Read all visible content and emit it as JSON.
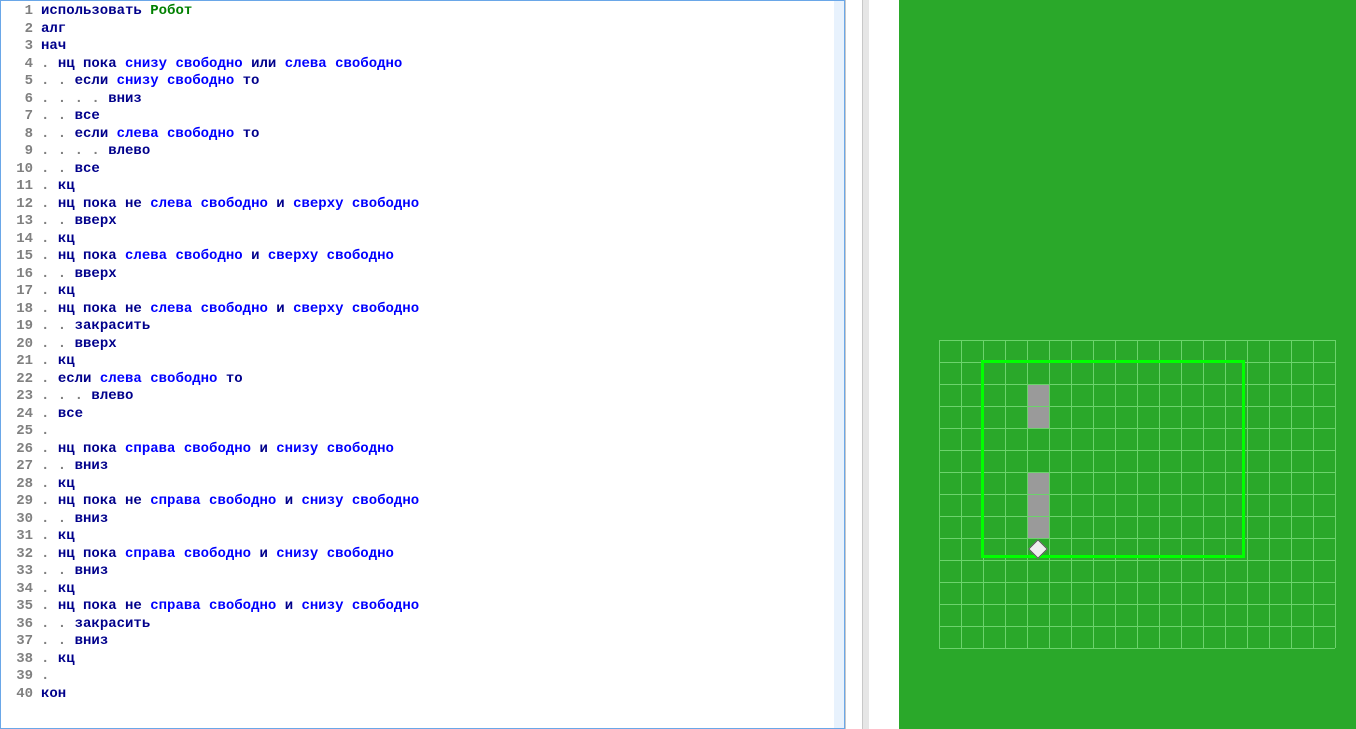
{
  "code": {
    "lines": [
      {
        "n": 1,
        "indent": 0,
        "tokens": [
          [
            "use",
            "использовать"
          ],
          [
            "sp",
            " "
          ],
          [
            "mod",
            "Робот"
          ]
        ]
      },
      {
        "n": 2,
        "indent": 0,
        "tokens": [
          [
            "kw",
            "алг"
          ]
        ]
      },
      {
        "n": 3,
        "indent": 0,
        "tokens": [
          [
            "kw",
            "нач"
          ]
        ]
      },
      {
        "n": 4,
        "indent": 1,
        "tokens": [
          [
            "kw",
            "нц пока"
          ],
          [
            "sp",
            " "
          ],
          [
            "cond",
            "снизу свободно"
          ],
          [
            "sp",
            " "
          ],
          [
            "kw",
            "или"
          ],
          [
            "sp",
            " "
          ],
          [
            "cond",
            "слева свободно"
          ]
        ]
      },
      {
        "n": 5,
        "indent": 2,
        "tokens": [
          [
            "kw",
            "если"
          ],
          [
            "sp",
            " "
          ],
          [
            "cond",
            "снизу свободно"
          ],
          [
            "sp",
            " "
          ],
          [
            "kw",
            "то"
          ]
        ]
      },
      {
        "n": 6,
        "indent": 4,
        "tokens": [
          [
            "cmd",
            "вниз"
          ]
        ]
      },
      {
        "n": 7,
        "indent": 2,
        "tokens": [
          [
            "kw",
            "все"
          ]
        ]
      },
      {
        "n": 8,
        "indent": 2,
        "tokens": [
          [
            "kw",
            "если"
          ],
          [
            "sp",
            " "
          ],
          [
            "cond",
            "слева свободно"
          ],
          [
            "sp",
            " "
          ],
          [
            "kw",
            "то"
          ]
        ]
      },
      {
        "n": 9,
        "indent": 4,
        "tokens": [
          [
            "cmd",
            "влево"
          ]
        ]
      },
      {
        "n": 10,
        "indent": 2,
        "tokens": [
          [
            "kw",
            "все"
          ]
        ]
      },
      {
        "n": 11,
        "indent": 1,
        "tokens": [
          [
            "kw",
            "кц"
          ]
        ]
      },
      {
        "n": 12,
        "indent": 1,
        "tokens": [
          [
            "kw",
            "нц пока"
          ],
          [
            "sp",
            " "
          ],
          [
            "kw",
            "не"
          ],
          [
            "sp",
            " "
          ],
          [
            "cond",
            "слева свободно"
          ],
          [
            "sp",
            " "
          ],
          [
            "kw",
            "и"
          ],
          [
            "sp",
            " "
          ],
          [
            "cond",
            "сверху свободно"
          ]
        ]
      },
      {
        "n": 13,
        "indent": 2,
        "tokens": [
          [
            "cmd",
            "вверх"
          ]
        ]
      },
      {
        "n": 14,
        "indent": 1,
        "tokens": [
          [
            "kw",
            "кц"
          ]
        ]
      },
      {
        "n": 15,
        "indent": 1,
        "tokens": [
          [
            "kw",
            "нц пока"
          ],
          [
            "sp",
            " "
          ],
          [
            "cond",
            "слева свободно"
          ],
          [
            "sp",
            " "
          ],
          [
            "kw",
            "и"
          ],
          [
            "sp",
            " "
          ],
          [
            "cond",
            "сверху свободно"
          ]
        ]
      },
      {
        "n": 16,
        "indent": 2,
        "tokens": [
          [
            "cmd",
            "вверх"
          ]
        ]
      },
      {
        "n": 17,
        "indent": 1,
        "tokens": [
          [
            "kw",
            "кц"
          ]
        ]
      },
      {
        "n": 18,
        "indent": 1,
        "tokens": [
          [
            "kw",
            "нц пока"
          ],
          [
            "sp",
            " "
          ],
          [
            "kw",
            "не"
          ],
          [
            "sp",
            " "
          ],
          [
            "cond",
            "слева свободно"
          ],
          [
            "sp",
            " "
          ],
          [
            "kw",
            "и"
          ],
          [
            "sp",
            " "
          ],
          [
            "cond",
            "сверху свободно"
          ]
        ]
      },
      {
        "n": 19,
        "indent": 2,
        "tokens": [
          [
            "cmd",
            "закрасить"
          ]
        ]
      },
      {
        "n": 20,
        "indent": 2,
        "tokens": [
          [
            "cmd",
            "вверх"
          ]
        ]
      },
      {
        "n": 21,
        "indent": 1,
        "tokens": [
          [
            "kw",
            "кц"
          ]
        ]
      },
      {
        "n": 22,
        "indent": 1,
        "tokens": [
          [
            "kw",
            "если"
          ],
          [
            "sp",
            " "
          ],
          [
            "cond",
            "слева свободно"
          ],
          [
            "sp",
            " "
          ],
          [
            "kw",
            "то"
          ]
        ]
      },
      {
        "n": 23,
        "indent": 3,
        "tokens": [
          [
            "cmd",
            "влево"
          ]
        ]
      },
      {
        "n": 24,
        "indent": 1,
        "tokens": [
          [
            "kw",
            "все"
          ]
        ]
      },
      {
        "n": 25,
        "indent": 1,
        "tokens": []
      },
      {
        "n": 26,
        "indent": 1,
        "tokens": [
          [
            "kw",
            "нц пока"
          ],
          [
            "sp",
            " "
          ],
          [
            "cond",
            "справа свободно"
          ],
          [
            "sp",
            " "
          ],
          [
            "kw",
            "и"
          ],
          [
            "sp",
            " "
          ],
          [
            "cond",
            "снизу свободно"
          ]
        ]
      },
      {
        "n": 27,
        "indent": 2,
        "tokens": [
          [
            "cmd",
            "вниз"
          ]
        ]
      },
      {
        "n": 28,
        "indent": 1,
        "tokens": [
          [
            "kw",
            "кц"
          ]
        ]
      },
      {
        "n": 29,
        "indent": 1,
        "tokens": [
          [
            "kw",
            "нц пока"
          ],
          [
            "sp",
            " "
          ],
          [
            "kw",
            "не"
          ],
          [
            "sp",
            " "
          ],
          [
            "cond",
            "справа свободно"
          ],
          [
            "sp",
            " "
          ],
          [
            "kw",
            "и"
          ],
          [
            "sp",
            " "
          ],
          [
            "cond",
            "снизу свободно"
          ]
        ]
      },
      {
        "n": 30,
        "indent": 2,
        "tokens": [
          [
            "cmd",
            "вниз"
          ]
        ]
      },
      {
        "n": 31,
        "indent": 1,
        "tokens": [
          [
            "kw",
            "кц"
          ]
        ]
      },
      {
        "n": 32,
        "indent": 1,
        "tokens": [
          [
            "kw",
            "нц пока"
          ],
          [
            "sp",
            " "
          ],
          [
            "cond",
            "справа свободно"
          ],
          [
            "sp",
            " "
          ],
          [
            "kw",
            "и"
          ],
          [
            "sp",
            " "
          ],
          [
            "cond",
            "снизу свободно"
          ]
        ]
      },
      {
        "n": 33,
        "indent": 2,
        "tokens": [
          [
            "cmd",
            "вниз"
          ]
        ]
      },
      {
        "n": 34,
        "indent": 1,
        "tokens": [
          [
            "kw",
            "кц"
          ]
        ]
      },
      {
        "n": 35,
        "indent": 1,
        "tokens": [
          [
            "kw",
            "нц пока"
          ],
          [
            "sp",
            " "
          ],
          [
            "kw",
            "не"
          ],
          [
            "sp",
            " "
          ],
          [
            "cond",
            "справа свободно"
          ],
          [
            "sp",
            " "
          ],
          [
            "kw",
            "и"
          ],
          [
            "sp",
            " "
          ],
          [
            "cond",
            "снизу свободно"
          ]
        ]
      },
      {
        "n": 36,
        "indent": 2,
        "tokens": [
          [
            "cmd",
            "закрасить"
          ]
        ]
      },
      {
        "n": 37,
        "indent": 2,
        "tokens": [
          [
            "cmd",
            "вниз"
          ]
        ]
      },
      {
        "n": 38,
        "indent": 1,
        "tokens": [
          [
            "kw",
            "кц"
          ]
        ]
      },
      {
        "n": 39,
        "indent": 1,
        "tokens": []
      },
      {
        "n": 40,
        "indent": 0,
        "tokens": [
          [
            "kw",
            "кон"
          ]
        ]
      }
    ],
    "dot": ". "
  },
  "robot_field": {
    "cell_size": 22,
    "grid_cols": 18,
    "grid_rows": 14,
    "boundary": {
      "col": 2,
      "row": 1,
      "w": 12,
      "h": 9
    },
    "filled_cells": [
      {
        "col": 4,
        "row": 2
      },
      {
        "col": 4,
        "row": 3
      },
      {
        "col": 4,
        "row": 6
      },
      {
        "col": 4,
        "row": 7
      },
      {
        "col": 4,
        "row": 8
      }
    ],
    "robot_pos": {
      "col": 4,
      "row": 9
    }
  }
}
